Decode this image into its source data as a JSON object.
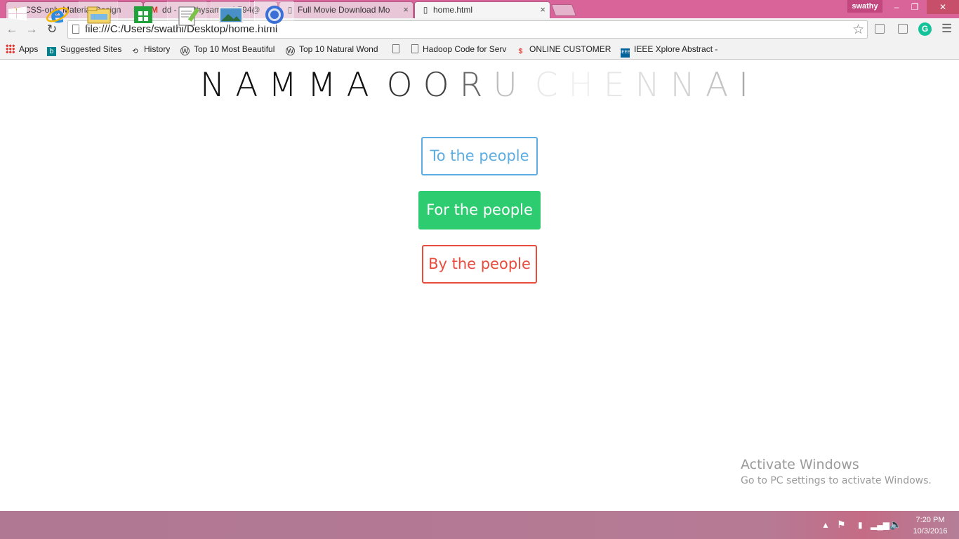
{
  "browser": {
    "tabs": [
      {
        "title": "CSS-only Material Design",
        "icon": "codepen-x-icon",
        "active": false
      },
      {
        "title": "dd - swathysampath794@",
        "icon": "gmail-icon",
        "active": false
      },
      {
        "title": "Full Movie Download Mo",
        "icon": "page-icon",
        "active": false
      },
      {
        "title": "home.html",
        "icon": "page-icon",
        "active": true
      }
    ],
    "user_name": "swathy",
    "url": "file:///C:/Users/swathi/Desktop/home.html",
    "bookmarks": [
      {
        "label": "Apps",
        "icon": "apps-grid-icon"
      },
      {
        "label": "Suggested Sites",
        "icon": "bing-icon"
      },
      {
        "label": "History",
        "icon": "history-icon"
      },
      {
        "label": "Top 10 Most Beautiful",
        "icon": "wordpress-icon"
      },
      {
        "label": "Top 10 Natural Wond",
        "icon": "wordpress-icon"
      },
      {
        "label": "",
        "icon": "page-icon"
      },
      {
        "label": "Hadoop Code for Serv",
        "icon": "page-icon"
      },
      {
        "label": "ONLINE CUSTOMER E",
        "icon": "dollar-icon"
      },
      {
        "label": "IEEE Xplore Abstract -",
        "icon": "ieee-icon"
      }
    ]
  },
  "page": {
    "heading_letters": [
      "N",
      "A",
      "M",
      "M",
      "A",
      " ",
      "O",
      "O",
      "R",
      "U",
      " ",
      "C",
      "H",
      "E",
      "N",
      "N",
      "A",
      "I"
    ],
    "buttons": {
      "to": "To the people",
      "for": "For the people",
      "by": "By the people"
    },
    "colors": {
      "blue": "#5dade2",
      "green": "#2ecc71",
      "red": "#e74c3c"
    }
  },
  "watermark": {
    "title": "Activate Windows",
    "subtitle": "Go to PC settings to activate Windows."
  },
  "taskbar": {
    "apps": [
      "windows-start-icon",
      "internet-explorer-icon",
      "file-explorer-icon",
      "store-icon",
      "notepad-plus-icon",
      "photos-icon",
      "chrome-icon"
    ],
    "time": "7:20 PM",
    "date": "10/3/2016"
  }
}
